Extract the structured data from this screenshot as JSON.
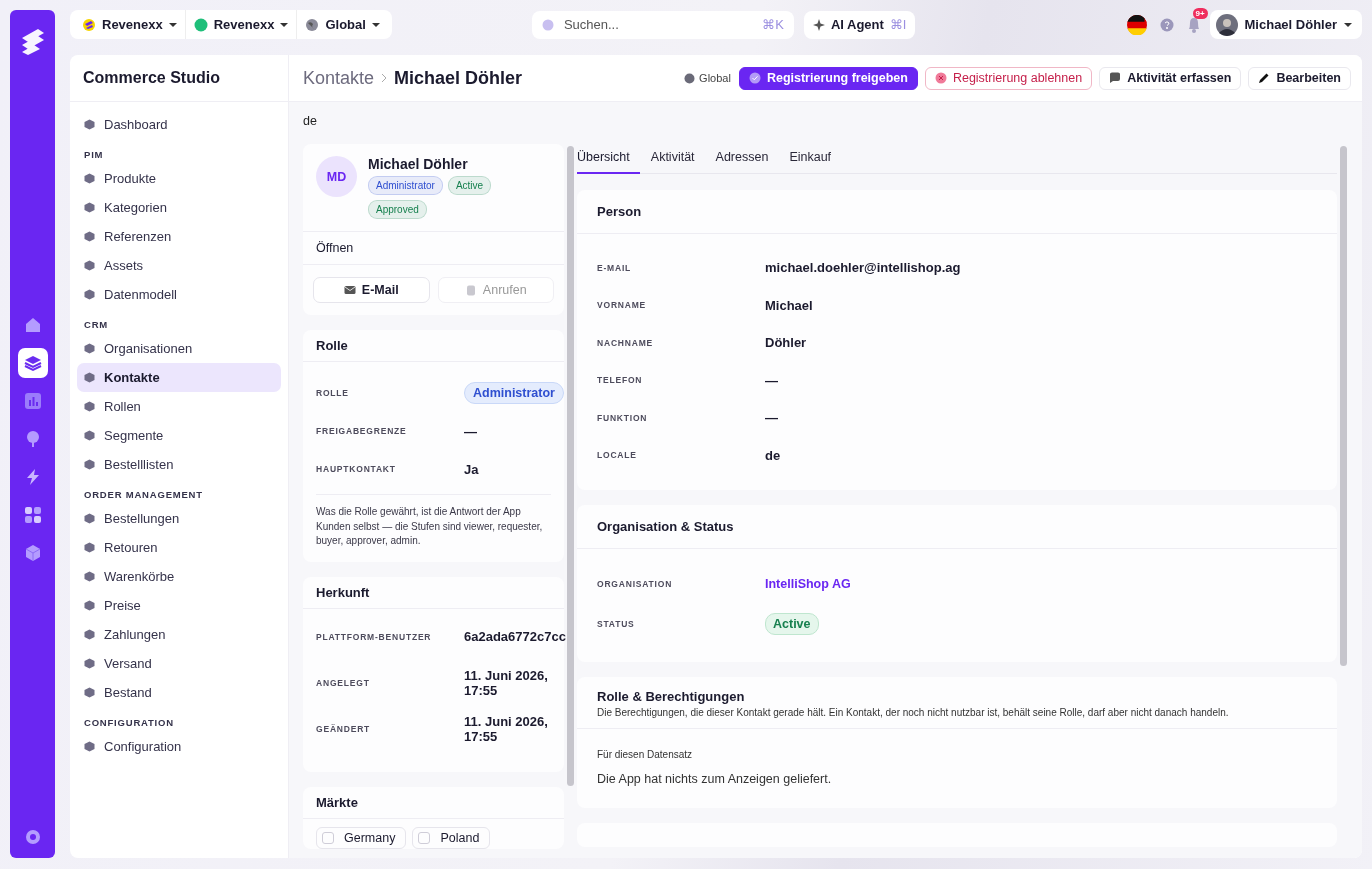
{
  "rail": {
    "items": [
      {
        "kind": "home",
        "selected": false
      },
      {
        "kind": "layers",
        "selected": true
      },
      {
        "kind": "chart",
        "selected": false
      },
      {
        "kind": "pin",
        "selected": false
      },
      {
        "kind": "bolt",
        "selected": false
      },
      {
        "kind": "apps",
        "selected": false
      },
      {
        "kind": "cube",
        "selected": false
      }
    ]
  },
  "top_bar": {
    "switchers": [
      {
        "label": "Revenexx",
        "kind": "logo"
      },
      {
        "label": "Revenexx",
        "kind": "dot"
      },
      {
        "label": "Global",
        "kind": "globe"
      }
    ],
    "search": {
      "placeholder": "Suchen...",
      "shortcut": "⌘K"
    },
    "ai_agent": {
      "label": "AI Agent",
      "shortcut": "⌘I"
    },
    "notification_count": "9+",
    "user": {
      "name": "Michael Döhler"
    }
  },
  "sidebar": {
    "title": "Commerce Studio",
    "items": [
      {
        "kind": "link",
        "label": "Dashboard",
        "selected": false
      },
      {
        "kind": "section",
        "label": "PIM"
      },
      {
        "kind": "link",
        "label": "Produkte",
        "selected": false
      },
      {
        "kind": "link",
        "label": "Kategorien",
        "selected": false
      },
      {
        "kind": "link",
        "label": "Referenzen",
        "selected": false
      },
      {
        "kind": "link",
        "label": "Assets",
        "selected": false
      },
      {
        "kind": "link",
        "label": "Datenmodell",
        "selected": false
      },
      {
        "kind": "section",
        "label": "CRM"
      },
      {
        "kind": "link",
        "label": "Organisationen",
        "selected": false
      },
      {
        "kind": "link",
        "label": "Kontakte",
        "selected": true
      },
      {
        "kind": "link",
        "label": "Rollen",
        "selected": false
      },
      {
        "kind": "link",
        "label": "Segmente",
        "selected": false
      },
      {
        "kind": "link",
        "label": "Bestelllisten",
        "selected": false
      },
      {
        "kind": "section",
        "label": "ORDER MANAGEMENT"
      },
      {
        "kind": "link",
        "label": "Bestellungen",
        "selected": false
      },
      {
        "kind": "link",
        "label": "Retouren",
        "selected": false
      },
      {
        "kind": "link",
        "label": "Warenkörbe",
        "selected": false
      },
      {
        "kind": "link",
        "label": "Preise",
        "selected": false
      },
      {
        "kind": "link",
        "label": "Zahlungen",
        "selected": false
      },
      {
        "kind": "link",
        "label": "Versand",
        "selected": false
      },
      {
        "kind": "link",
        "label": "Bestand",
        "selected": false
      },
      {
        "kind": "section",
        "label": "CONFIGURATION"
      },
      {
        "kind": "link",
        "label": "Configuration",
        "selected": false
      }
    ]
  },
  "header": {
    "breadcrumb": "Kontakte",
    "title": "Michael Döhler",
    "scope": "Global",
    "actions": [
      {
        "label": "Registrierung freigeben",
        "kind": "primary"
      },
      {
        "label": "Registrierung ablehnen",
        "kind": "danger"
      },
      {
        "label": "Aktivität erfassen",
        "kind": "activity"
      },
      {
        "label": "Bearbeiten",
        "kind": "edit"
      }
    ]
  },
  "locale_line": "de",
  "profile": {
    "initials": "MD",
    "name": "Michael Döhler",
    "badges": [
      {
        "label": "Administrator",
        "color": "#2f4fd0"
      },
      {
        "label": "Active",
        "color": "#17804f"
      },
      {
        "label": "Approved",
        "color": "#17804f"
      }
    ],
    "open_label": "Öffnen",
    "buttons": [
      {
        "label": "E-Mail",
        "kind": "mail",
        "disabled": false
      },
      {
        "label": "Anrufen",
        "kind": "phone",
        "disabled": true
      }
    ]
  },
  "role_card": {
    "title": "Rolle",
    "fields": [
      {
        "label": "ROLLE",
        "value": "Administrator",
        "kind": "badge"
      },
      {
        "label": "FREIGABEGRENZE",
        "value": "—"
      },
      {
        "label": "HAUPTKONTAKT",
        "value": "Ja"
      }
    ],
    "note": "Was die Rolle gewährt, ist die Antwort der App Kunden selbst — die Stufen sind viewer, requester, buyer, approver, admin."
  },
  "origin_card": {
    "title": "Herkunft",
    "fields": [
      {
        "label": "PLATTFORM-BENUTZER",
        "value": "6a2ada6772c7cc"
      },
      {
        "label": "ANGELEGT",
        "value": "11. Juni 2026, 17:55"
      },
      {
        "label": "GEÄNDERT",
        "value": "11. Juni 2026, 17:55"
      }
    ]
  },
  "markets_card": {
    "title": "Märkte",
    "markets": [
      {
        "label": "Germany",
        "checked": false
      },
      {
        "label": "Poland",
        "checked": false
      }
    ]
  },
  "tabs": [
    {
      "label": "Übersicht",
      "selected": true
    },
    {
      "label": "Aktivität",
      "selected": false
    },
    {
      "label": "Adressen",
      "selected": false
    },
    {
      "label": "Einkauf",
      "selected": false
    }
  ],
  "person_card": {
    "title": "Person",
    "fields": [
      {
        "label": "E-MAIL",
        "value": "michael.doehler@intellishop.ag"
      },
      {
        "label": "VORNAME",
        "value": "Michael"
      },
      {
        "label": "NACHNAME",
        "value": "Döhler"
      },
      {
        "label": "TELEFON",
        "value": "—"
      },
      {
        "label": "FUNKTION",
        "value": "—"
      },
      {
        "label": "LOCALE",
        "value": "de"
      }
    ]
  },
  "org_card": {
    "title": "Organisation & Status",
    "fields": [
      {
        "label": "ORGANISATION",
        "value": "IntelliShop AG",
        "kind": "link"
      },
      {
        "label": "STATUS",
        "value": "Active",
        "kind": "status"
      }
    ]
  },
  "permissions_card": {
    "title": "Rolle & Berechtigungen",
    "subtitle": "Die Berechtigungen, die dieser Kontakt gerade hält. Ein Kontakt, der noch nicht nutzbar ist, behält seine Rolle, darf aber nicht danach handeln.",
    "section_label": "Für diesen Datensatz",
    "empty_text": "Die App hat nichts zum Anzeigen geliefert."
  }
}
